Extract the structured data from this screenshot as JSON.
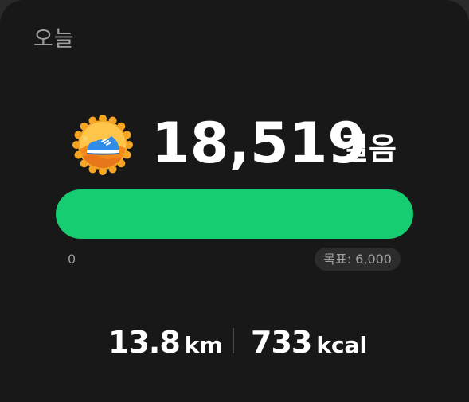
{
  "header": {
    "title": "오늘"
  },
  "steps": {
    "value": "18,519",
    "unit": "걸음",
    "badge_icon": "running-shoe-badge-icon",
    "progress_fraction": 1.0,
    "scale_start": "0",
    "goal_label": "목표: 6,000"
  },
  "stats": {
    "distance_value": "13.8",
    "distance_unit": "km",
    "calories_value": "733",
    "calories_unit": "kcal"
  },
  "colors": {
    "background": "#181818",
    "progress_green": "#16cd72",
    "badge_orange": "#f3a523",
    "shoe_blue": "#2f8ce8"
  }
}
